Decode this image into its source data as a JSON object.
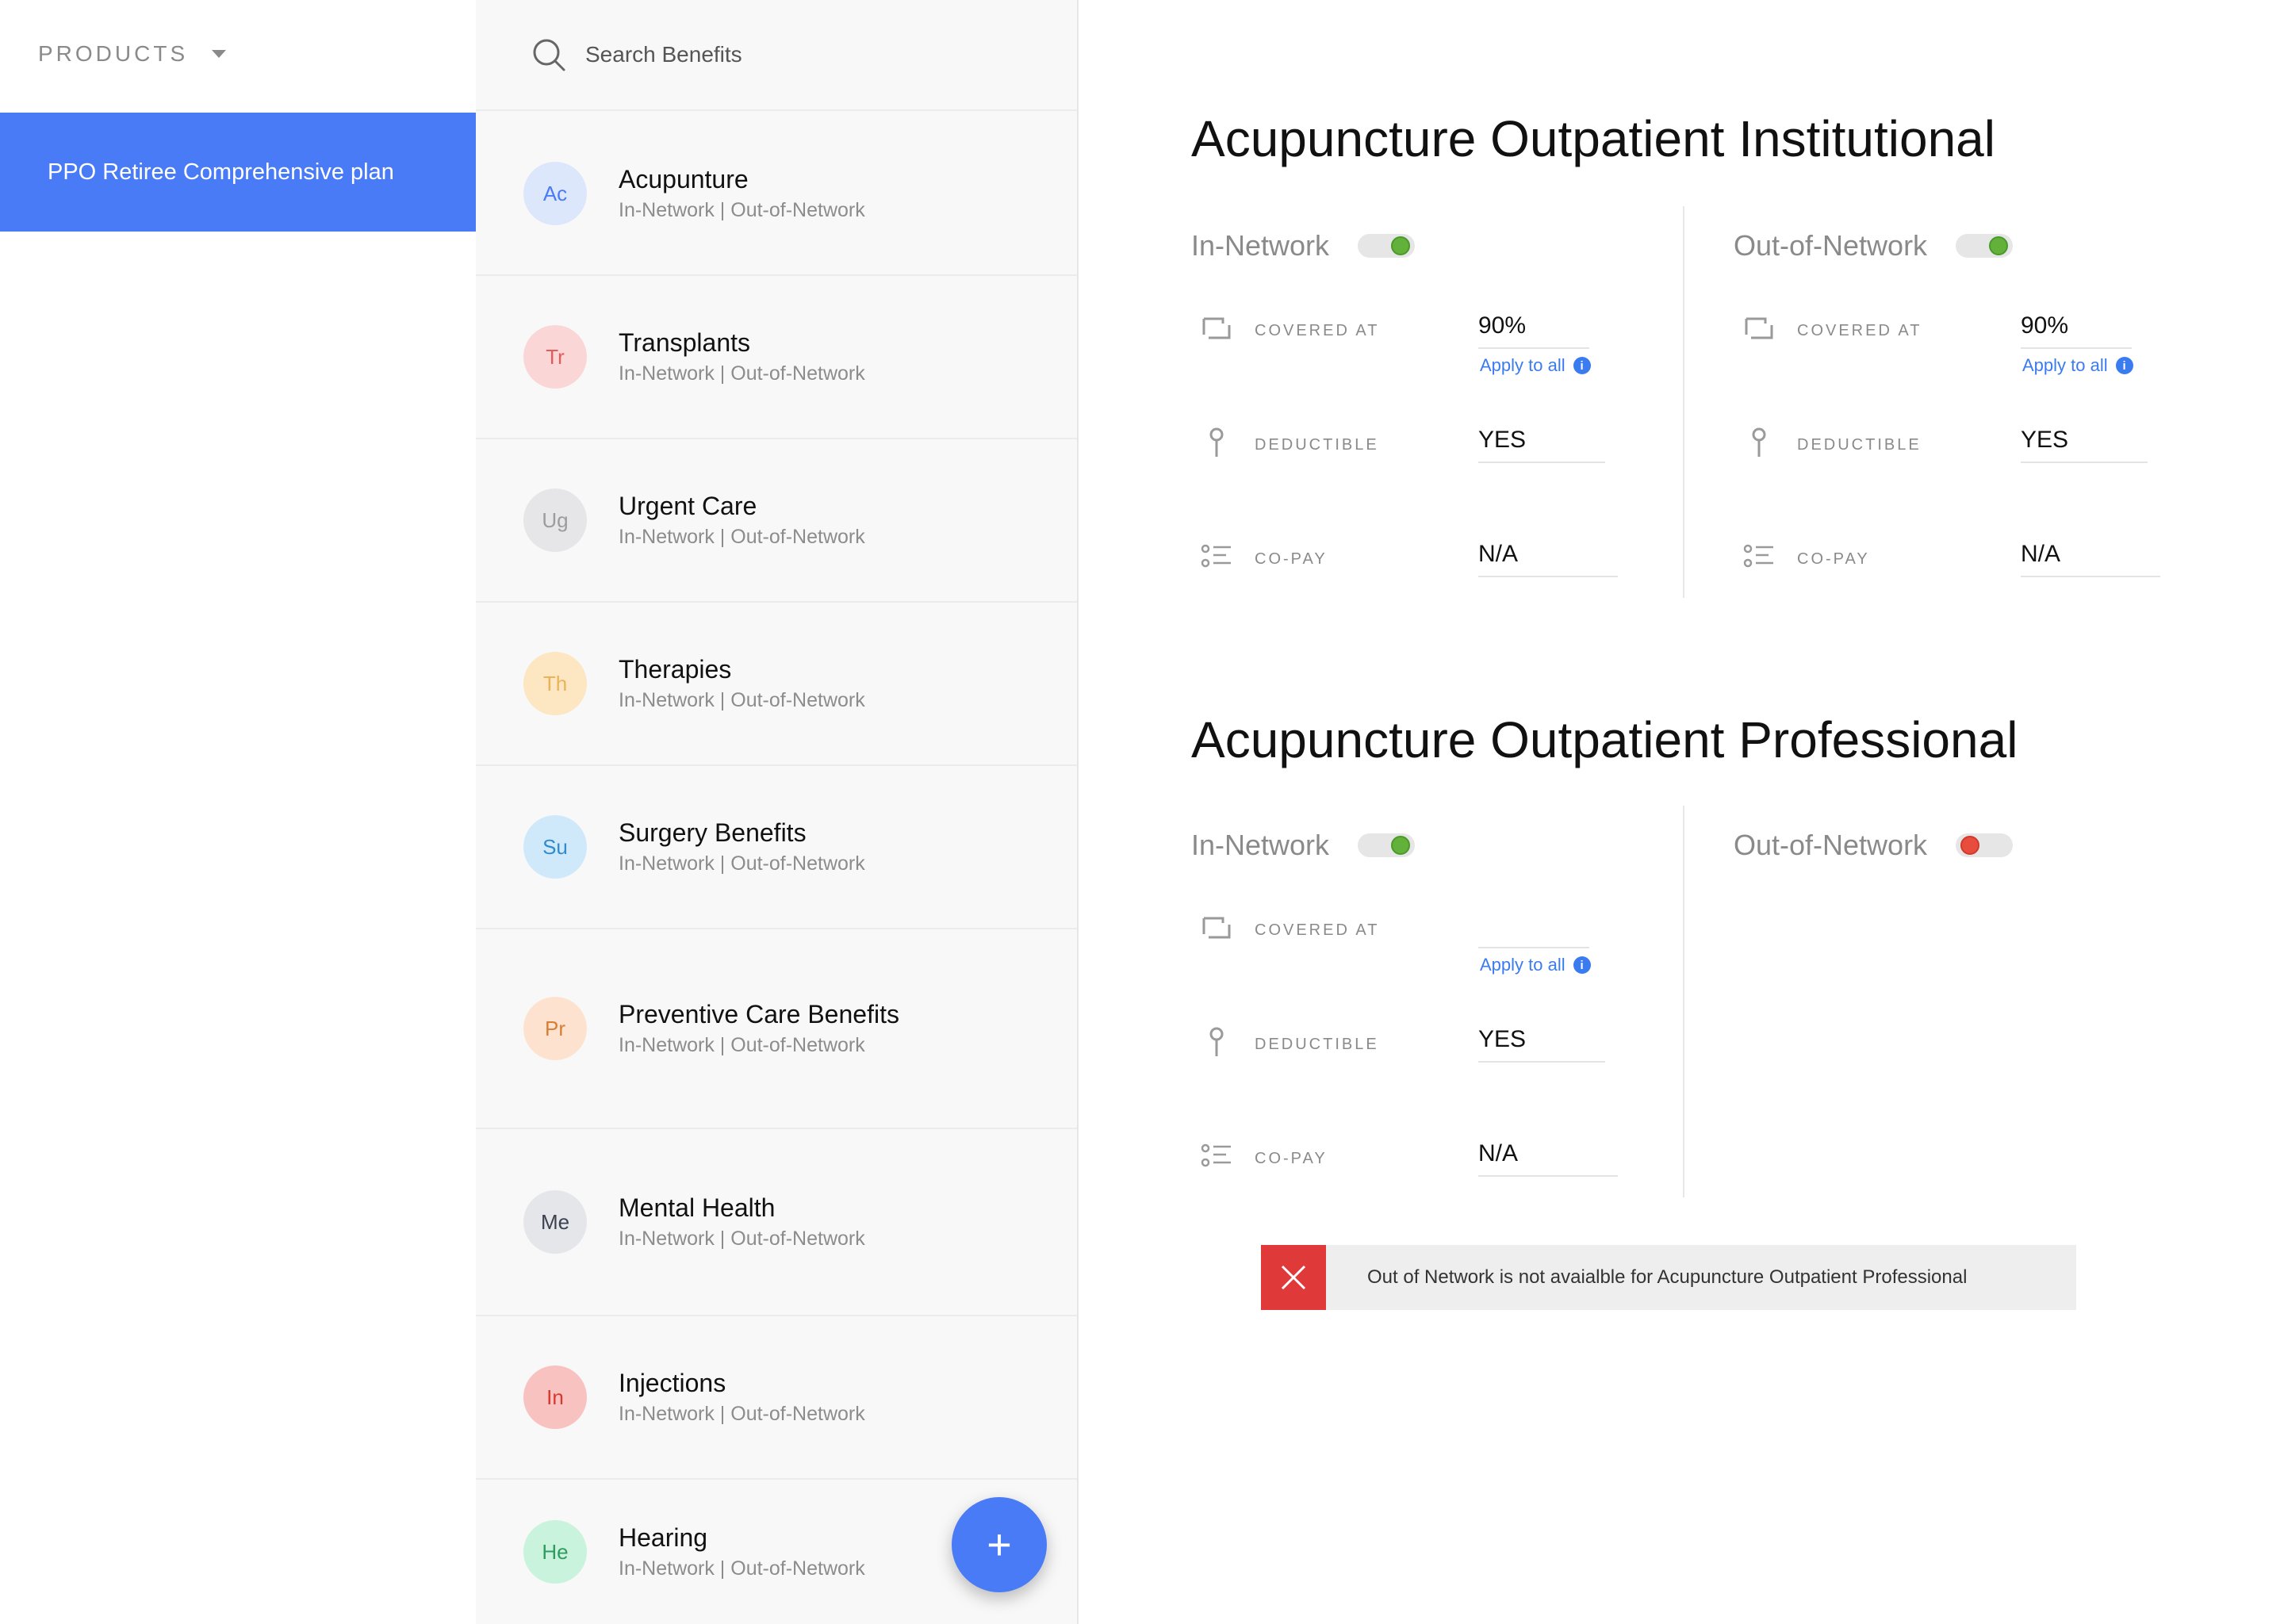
{
  "sidebar": {
    "header_label": "PRODUCTS",
    "selected_product": "PPO Retiree Comprehensive plan"
  },
  "search": {
    "placeholder": "Search Benefits"
  },
  "benefits": [
    {
      "initials": "Ac",
      "name": "Acupunture",
      "sub": "In-Network | Out-of-Network",
      "bg": "#dde7fb",
      "fg": "#4a7bf7"
    },
    {
      "initials": "Tr",
      "name": "Transplants",
      "sub": "In-Network | Out-of-Network",
      "bg": "#fbd6d6",
      "fg": "#e35b5b"
    },
    {
      "initials": "Ug",
      "name": "Urgent Care",
      "sub": "In-Network | Out-of-Network",
      "bg": "#e6e6e8",
      "fg": "#9b9ba0"
    },
    {
      "initials": "Th",
      "name": "Therapies",
      "sub": "In-Network | Out-of-Network",
      "bg": "#fde6c2",
      "fg": "#e9b35a"
    },
    {
      "initials": "Su",
      "name": "Surgery Benefits",
      "sub": "In-Network | Out-of-Network",
      "bg": "#cfe9fb",
      "fg": "#2f8bcf"
    },
    {
      "initials": "Pr",
      "name": "Preventive Care Benefits",
      "sub": "In-Network | Out-of-Network",
      "bg": "#fde3cf",
      "fg": "#d67e35"
    },
    {
      "initials": "Me",
      "name": "Mental Health",
      "sub": "In-Network | Out-of-Network",
      "bg": "#e4e6ea",
      "fg": "#3b4250"
    },
    {
      "initials": "In",
      "name": "Injections",
      "sub": "In-Network | Out-of-Network",
      "bg": "#f7c2c0",
      "fg": "#d6392f"
    },
    {
      "initials": "He",
      "name": "Hearing",
      "sub": "In-Network | Out-of-Network",
      "bg": "#c9f3dc",
      "fg": "#2f9b62"
    }
  ],
  "fab_label": "+",
  "sections": [
    {
      "title": "Acupuncture Outpatient Institutional",
      "in_network": {
        "label": "In-Network",
        "enabled": true,
        "covered_label": "COVERED AT",
        "covered_value": "90%",
        "apply_label": "Apply to all",
        "deductible_label": "DEDUCTIBLE",
        "deductible_value": "YES",
        "copay_label": "CO-PAY",
        "copay_value": "N/A"
      },
      "out_network": {
        "label": "Out-of-Network",
        "enabled": true,
        "covered_label": "COVERED AT",
        "covered_value": "90%",
        "apply_label": "Apply to all",
        "deductible_label": "DEDUCTIBLE",
        "deductible_value": "YES",
        "copay_label": "CO-PAY",
        "copay_value": "N/A"
      }
    },
    {
      "title": "Acupuncture Outpatient Professional",
      "in_network": {
        "label": "In-Network",
        "enabled": true,
        "covered_label": "COVERED AT",
        "covered_value": "",
        "apply_label": "Apply to all",
        "deductible_label": "DEDUCTIBLE",
        "deductible_value": "YES",
        "copay_label": "CO-PAY",
        "copay_value": "N/A"
      },
      "out_network": {
        "label": "Out-of-Network",
        "enabled": false
      }
    }
  ],
  "alert": {
    "message": "Out of Network is not avaialble for Acupuncture Outpatient Professional"
  },
  "info_glyph": "i",
  "colors": {
    "accent": "#4a7bf7",
    "toggle_on": "#63b03b",
    "toggle_off": "#e84c3d",
    "alert_red": "#e0393a"
  }
}
